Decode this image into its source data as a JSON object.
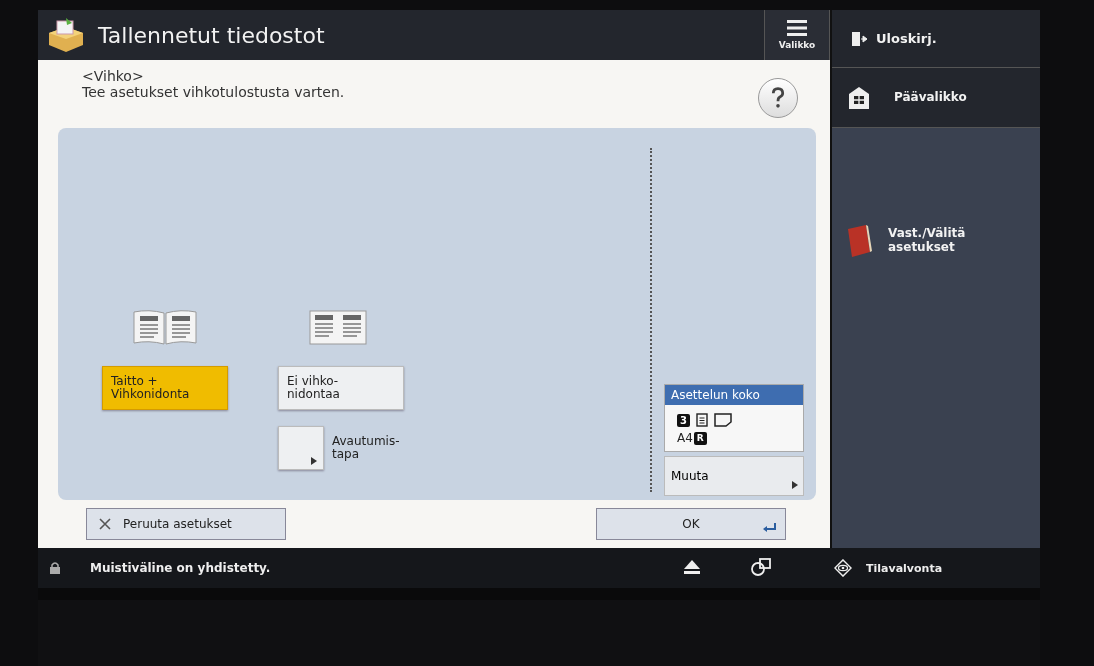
{
  "window": {
    "title": "Tallennetut tiedostot"
  },
  "menu_button": {
    "label": "Valikko"
  },
  "logout_button": {
    "label": "Uloskirj."
  },
  "header": {
    "section": "<Vihko>",
    "instruction": "Tee asetukset vihkotulostusta varten."
  },
  "binding_options": [
    {
      "label": "Taitto +\nVihkonidonta",
      "kind": "booklet",
      "selected": true
    },
    {
      "label": "Ei vihko-\nnidontaa",
      "kind": "flat",
      "selected": false
    }
  ],
  "opening_button": {
    "label": "Avautumis-\ntapa"
  },
  "layout_size": {
    "title": "Asettelun koko",
    "count": "3",
    "paper": "A4",
    "paper_mark": "R",
    "change_button": "Muuta"
  },
  "cancel_button": {
    "label": "Peruuta asetukset"
  },
  "ok_button": {
    "label": "OK"
  },
  "side_menu": [
    {
      "label": "Päävalikko",
      "kind": "home"
    },
    {
      "label": "Vast./Välitä\nasetukset",
      "kind": "book"
    }
  ],
  "status_bar": {
    "message": "Muistiväline on yhdistetty.",
    "monitor": "Tilavalvonta"
  }
}
